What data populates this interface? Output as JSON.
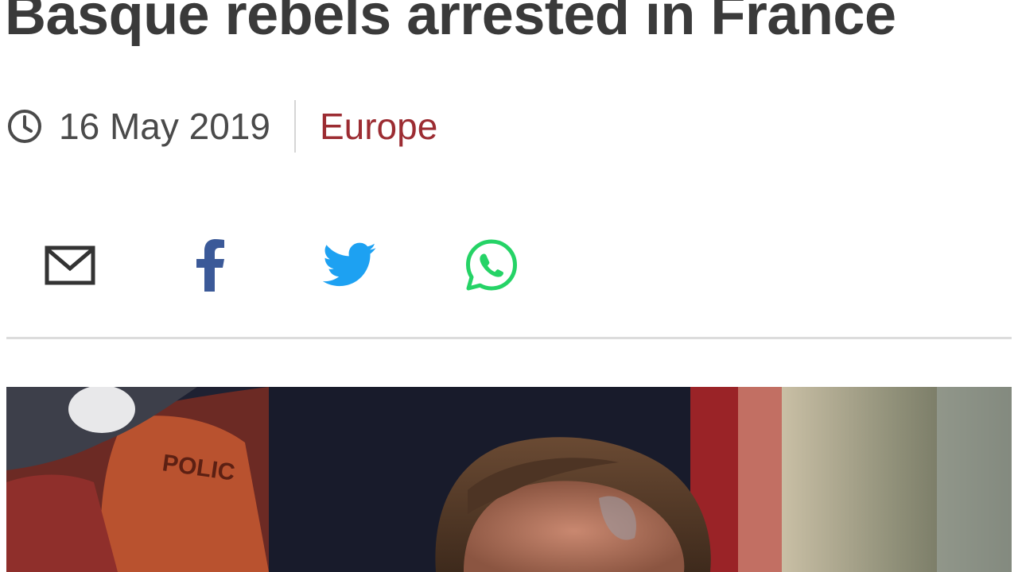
{
  "article": {
    "headline": "Basque rebels arrested in France",
    "date": "16 May 2019",
    "section": "Europe"
  },
  "share": {
    "buttons": [
      {
        "icon": "envelope-icon",
        "service": "email",
        "color": "#333333"
      },
      {
        "icon": "facebook-icon",
        "service": "facebook",
        "color": "#3b5998"
      },
      {
        "icon": "twitter-icon",
        "service": "twitter",
        "color": "#1da1f2"
      },
      {
        "icon": "whatsapp-icon",
        "service": "whatsapp",
        "color": "#25d366"
      }
    ]
  },
  "colors": {
    "headline": "#3a3a3a",
    "meta_text": "#4a4a4a",
    "section_link": "#9c2c32",
    "divider": "#dcdcdc"
  }
}
